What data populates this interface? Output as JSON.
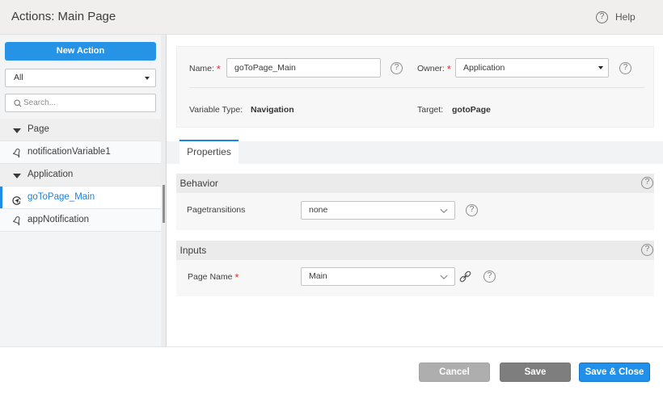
{
  "ui": {
    "required_marker": "*"
  },
  "header": {
    "title": "Actions: Main Page",
    "help_label": "Help"
  },
  "sidebar": {
    "new_action_label": "New Action",
    "filter_value": "All",
    "search_placeholder": "Search...",
    "tree": [
      {
        "type": "group",
        "label": "Page"
      },
      {
        "type": "item",
        "icon": "bell",
        "label": "notificationVariable1",
        "selected": false
      },
      {
        "type": "group",
        "label": "Application"
      },
      {
        "type": "item",
        "icon": "navigate",
        "label": "goToPage_Main",
        "selected": true
      },
      {
        "type": "item",
        "icon": "bell",
        "label": "appNotification",
        "selected": false
      }
    ]
  },
  "form": {
    "name_label": "Name:",
    "name_value": "goToPage_Main",
    "owner_label": "Owner:",
    "owner_value": "Application",
    "variable_type_label": "Variable Type:",
    "variable_type_value": "Navigation",
    "target_label": "Target:",
    "target_value": "gotoPage"
  },
  "tabs": [
    {
      "label": "Properties",
      "active": true
    }
  ],
  "sections": [
    {
      "title": "Behavior",
      "rows": [
        {
          "label": "Pagetransitions",
          "required": false,
          "value": "none",
          "has_link": false
        }
      ]
    },
    {
      "title": "Inputs",
      "rows": [
        {
          "label": "Page Name",
          "required": true,
          "value": "Main",
          "has_link": true
        }
      ]
    }
  ],
  "footer": {
    "buttons": [
      {
        "label": "Cancel"
      },
      {
        "label": "Save"
      },
      {
        "label": "Save & Close"
      }
    ]
  },
  "colors": {
    "accent_blue": "#2693e6",
    "tab_blue": "#1a86e6",
    "save_gray": "#7e7e7e",
    "cancel_gray": "#aeaeae"
  }
}
